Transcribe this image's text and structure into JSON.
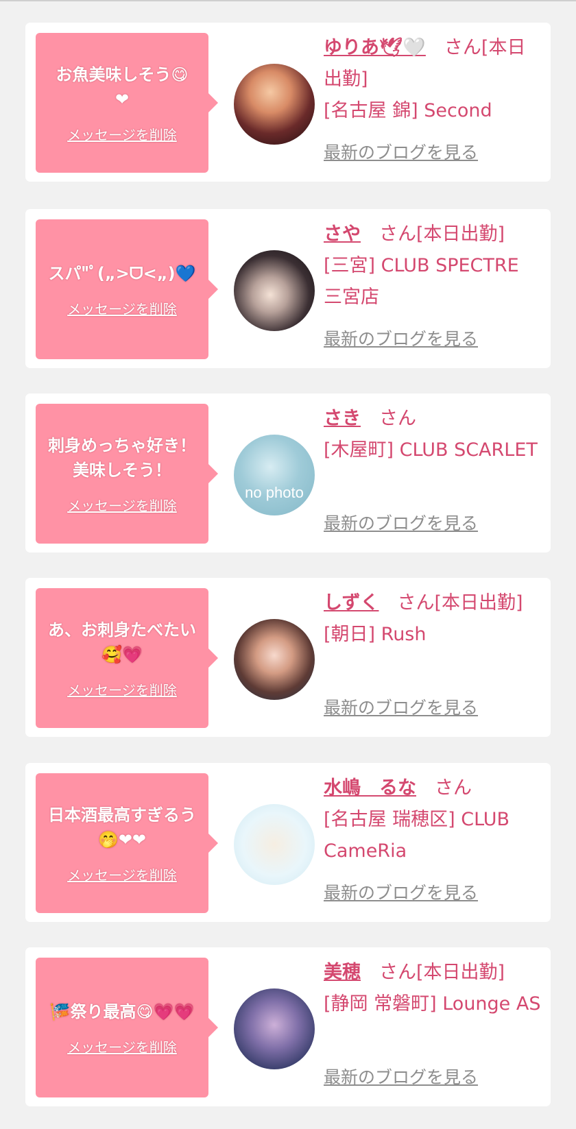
{
  "cards": [
    {
      "message": "お魚美味しそう😋\n❤",
      "delete_label": "メッセージを削除",
      "name": "ゆりあ🕊🤍",
      "suffix": "　さん[本日出勤]",
      "shop": "[名古屋 錦] Second",
      "blog_label": "最新のブログを見る"
    },
    {
      "message": "スパ\"ﾟ(„>ᗜ<„)💙",
      "delete_label": "メッセージを削除",
      "name": "さや",
      "suffix": "　さん[本日出勤]",
      "shop": "[三宮] CLUB SPECTRE 三宮店",
      "blog_label": "最新のブログを見る"
    },
    {
      "message": "刺身めっちゃ好き！美味しそう！",
      "delete_label": "メッセージを削除",
      "name": "さき",
      "suffix": "　さん",
      "shop": "[木屋町] CLUB SCARLET",
      "blog_label": "最新のブログを見る",
      "avatar_text": "no photo"
    },
    {
      "message": "あ、お刺身たべたい🥰💗",
      "delete_label": "メッセージを削除",
      "name": "しずく",
      "suffix": "　さん[本日出勤]",
      "shop": "[朝日] Rush",
      "blog_label": "最新のブログを見る"
    },
    {
      "message": "日本酒最高すぎるう🤭❤❤",
      "delete_label": "メッセージを削除",
      "name": "水嶋　るな",
      "suffix": "　さん",
      "shop": "[名古屋 瑞穂区] CLUB CameRia",
      "blog_label": "最新のブログを見る"
    },
    {
      "message": "🎏祭り最高😋💗💗",
      "delete_label": "メッセージを削除",
      "name": "美穂",
      "suffix": "　さん[本日出勤]",
      "shop": "[静岡 常磐町] Lounge AS",
      "blog_label": "最新のブログを見る"
    }
  ]
}
